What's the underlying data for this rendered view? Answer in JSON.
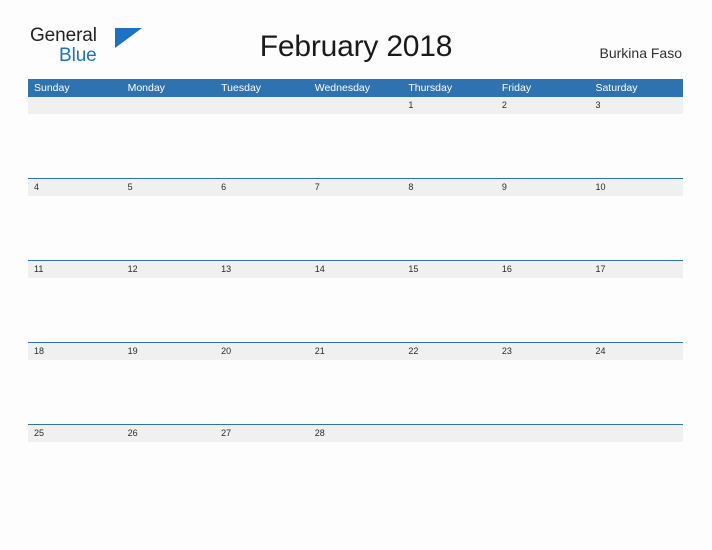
{
  "brand": {
    "name_part1": "General",
    "name_part2": "Blue",
    "flag_icon": "triangle-flag-icon",
    "accent_color": "#1b72c4"
  },
  "header": {
    "title": "February 2018",
    "country": "Burkina Faso"
  },
  "colors": {
    "header_blue": "#2e72b0",
    "date_band_gray": "#f0f0f0",
    "row_divider_blue": "#2e72b0",
    "page_background": "#fdfdfd",
    "title_text": "#1a1a1a"
  },
  "calendar": {
    "month": "February",
    "year": "2018",
    "weekday_headers": [
      "Sunday",
      "Monday",
      "Tuesday",
      "Wednesday",
      "Thursday",
      "Friday",
      "Saturday"
    ],
    "weeks": [
      {
        "days": [
          "",
          "",
          "",
          "",
          "1",
          "2",
          "3"
        ]
      },
      {
        "days": [
          "4",
          "5",
          "6",
          "7",
          "8",
          "9",
          "10"
        ]
      },
      {
        "days": [
          "11",
          "12",
          "13",
          "14",
          "15",
          "16",
          "17"
        ]
      },
      {
        "days": [
          "18",
          "19",
          "20",
          "21",
          "22",
          "23",
          "24"
        ]
      },
      {
        "days": [
          "25",
          "26",
          "27",
          "28",
          "",
          "",
          ""
        ]
      }
    ]
  }
}
